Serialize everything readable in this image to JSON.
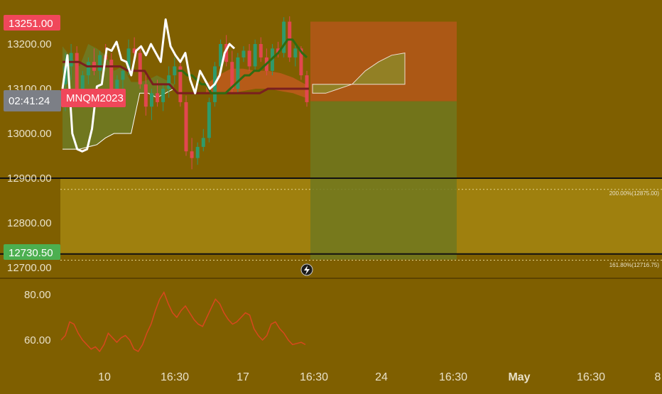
{
  "colors": {
    "background": "#7f5f00",
    "bull_candle": "#2f9a6a",
    "bear_candle": "#e2474f",
    "white_line": "#ffffff",
    "cloud_green": "#6f7a22",
    "cloud_red": "#c05a1c",
    "red_line": "#7a1f1f",
    "green_line": "#2f6b12",
    "fib_zone": "#a48610",
    "rsi_line": "#d8481e",
    "profit_zone": "#70781e",
    "loss_zone": "#b8561a",
    "badge_red": "#f0475a",
    "badge_green": "#4caf50",
    "badge_grey": "#7c7f86"
  },
  "badges": {
    "high_price": "13251.00",
    "countdown": "02:41:24",
    "symbol": "MNQM2023",
    "low_price": "12730.50"
  },
  "fib_labels": {
    "level_200": "200.00%(12875.00)",
    "level_161": "161.80%(12716.75)"
  },
  "rsi_icon": "lightning-icon",
  "chart_data": [
    {
      "type": "candlestick",
      "title": "",
      "ylabel": "",
      "xlabel": "",
      "yticks": [
        "13200.00",
        "13100.00",
        "13000.00",
        "12900.00",
        "12800.00",
        "12700.00"
      ],
      "yticks_values": [
        13200,
        13100,
        13000,
        12900,
        12800,
        12700
      ],
      "ylim": [
        12690,
        13260
      ],
      "xticks": [
        "10",
        "16:30",
        "17",
        "16:30",
        "24",
        "16:30",
        "May",
        "16:30",
        "8"
      ],
      "horizontal_lines": [
        12900,
        12730.5
      ],
      "fib_levels": [
        12875,
        12716.75
      ],
      "candles": [
        {
          "o": 13110,
          "h": 13180,
          "l": 13050,
          "c": 13150
        },
        {
          "o": 13150,
          "h": 13200,
          "l": 13120,
          "c": 13180
        },
        {
          "o": 13180,
          "h": 13195,
          "l": 13090,
          "c": 13100
        },
        {
          "o": 13100,
          "h": 13140,
          "l": 13060,
          "c": 13130
        },
        {
          "o": 13130,
          "h": 13170,
          "l": 13110,
          "c": 13160
        },
        {
          "o": 13160,
          "h": 13190,
          "l": 13130,
          "c": 13140
        },
        {
          "o": 13140,
          "h": 13185,
          "l": 13120,
          "c": 13175
        },
        {
          "o": 13175,
          "h": 13200,
          "l": 13150,
          "c": 13165
        },
        {
          "o": 13165,
          "h": 13180,
          "l": 13080,
          "c": 13090
        },
        {
          "o": 13090,
          "h": 13130,
          "l": 13060,
          "c": 13120
        },
        {
          "o": 13120,
          "h": 13150,
          "l": 13100,
          "c": 13140
        },
        {
          "o": 13140,
          "h": 13210,
          "l": 13130,
          "c": 13190
        },
        {
          "o": 13190,
          "h": 13215,
          "l": 13170,
          "c": 13180
        },
        {
          "o": 13180,
          "h": 13195,
          "l": 13100,
          "c": 13110
        },
        {
          "o": 13110,
          "h": 13140,
          "l": 13040,
          "c": 13060
        },
        {
          "o": 13060,
          "h": 13100,
          "l": 13030,
          "c": 13090
        },
        {
          "o": 13090,
          "h": 13120,
          "l": 13060,
          "c": 13070
        },
        {
          "o": 13070,
          "h": 13110,
          "l": 13050,
          "c": 13100
        },
        {
          "o": 13100,
          "h": 13150,
          "l": 13080,
          "c": 13130
        },
        {
          "o": 13130,
          "h": 13170,
          "l": 13110,
          "c": 13150
        },
        {
          "o": 13150,
          "h": 13165,
          "l": 13060,
          "c": 13070
        },
        {
          "o": 13070,
          "h": 13085,
          "l": 12950,
          "c": 12960
        },
        {
          "o": 12960,
          "h": 12990,
          "l": 12920,
          "c": 12945
        },
        {
          "o": 12945,
          "h": 12980,
          "l": 12930,
          "c": 12970
        },
        {
          "o": 12970,
          "h": 13010,
          "l": 12960,
          "c": 12990
        },
        {
          "o": 12990,
          "h": 13080,
          "l": 12980,
          "c": 13070
        },
        {
          "o": 13070,
          "h": 13160,
          "l": 13060,
          "c": 13150
        },
        {
          "o": 13150,
          "h": 13210,
          "l": 13140,
          "c": 13200
        },
        {
          "o": 13200,
          "h": 13220,
          "l": 13150,
          "c": 13160
        },
        {
          "o": 13160,
          "h": 13185,
          "l": 13090,
          "c": 13100
        },
        {
          "o": 13100,
          "h": 13180,
          "l": 13090,
          "c": 13170
        },
        {
          "o": 13170,
          "h": 13195,
          "l": 13160,
          "c": 13185
        },
        {
          "o": 13185,
          "h": 13200,
          "l": 13140,
          "c": 13150
        },
        {
          "o": 13150,
          "h": 13210,
          "l": 13140,
          "c": 13200
        },
        {
          "o": 13200,
          "h": 13215,
          "l": 13160,
          "c": 13170
        },
        {
          "o": 13170,
          "h": 13190,
          "l": 13130,
          "c": 13140
        },
        {
          "o": 13140,
          "h": 13200,
          "l": 13130,
          "c": 13190
        },
        {
          "o": 13190,
          "h": 13205,
          "l": 13170,
          "c": 13180
        },
        {
          "o": 13180,
          "h": 13260,
          "l": 13170,
          "c": 13250
        },
        {
          "o": 13250,
          "h": 13262,
          "l": 13160,
          "c": 13170
        },
        {
          "o": 13170,
          "h": 13200,
          "l": 13150,
          "c": 13190
        },
        {
          "o": 13190,
          "h": 13195,
          "l": 13120,
          "c": 13130
        },
        {
          "o": 13130,
          "h": 13140,
          "l": 13060,
          "c": 13070
        }
      ],
      "white_line": [
        13100,
        13175,
        13000,
        12965,
        12960,
        12965,
        13010,
        13105,
        13110,
        13190,
        13185,
        13205,
        13165,
        13160,
        13130,
        13185,
        13195,
        13175,
        13200,
        13180,
        13160,
        13255,
        13195,
        13175,
        13160,
        13180,
        13120,
        13090,
        13140,
        13120,
        13100,
        13110,
        13130,
        13180,
        13200,
        13190
      ],
      "red_line": [
        13160,
        13160,
        13160,
        13150,
        13150,
        13150,
        13150,
        13150,
        13140,
        13140,
        13140,
        13110,
        13110,
        13110,
        13090,
        13090,
        13090,
        13090,
        13090,
        13090,
        13090,
        13090,
        13090,
        13090,
        13090,
        13100,
        13100,
        13100,
        13100,
        13100,
        13100
      ],
      "green_line": [
        13140,
        13140,
        13130,
        13130,
        13120,
        13110,
        13110,
        13090,
        13090,
        13090,
        13090,
        13100,
        13110,
        13120,
        13130,
        13130,
        13140,
        13140,
        13150,
        13160,
        13170,
        13180,
        13195,
        13210,
        13210,
        13195,
        13180,
        13170
      ],
      "future_cloud_span_a": [
        13090,
        13090,
        13100,
        13110,
        13140,
        13160,
        13175,
        13180
      ],
      "future_cloud_span_b": [
        13110,
        13110,
        13110,
        13110,
        13110,
        13110,
        13110,
        13110
      ],
      "position": {
        "entry": 13072,
        "target": 12718,
        "stop": 13250
      }
    },
    {
      "type": "line",
      "title": "",
      "ylabel": "",
      "xlabel": "",
      "yticks": [
        "80.00",
        "60.00"
      ],
      "yticks_values": [
        80,
        60
      ],
      "ylim": [
        52,
        87
      ],
      "values": [
        60,
        62,
        68,
        67,
        63,
        60,
        58,
        56,
        57,
        55,
        58,
        63,
        61,
        59,
        61,
        62,
        60,
        56,
        55,
        58,
        63,
        67,
        73,
        78,
        81,
        76,
        72,
        70,
        73,
        75,
        72,
        69,
        67,
        66,
        70,
        74,
        78,
        76,
        72,
        69,
        67,
        68,
        70,
        72,
        71,
        65,
        62,
        60,
        62,
        67,
        68,
        65,
        63,
        60,
        58,
        58.5,
        59,
        58
      ]
    }
  ]
}
